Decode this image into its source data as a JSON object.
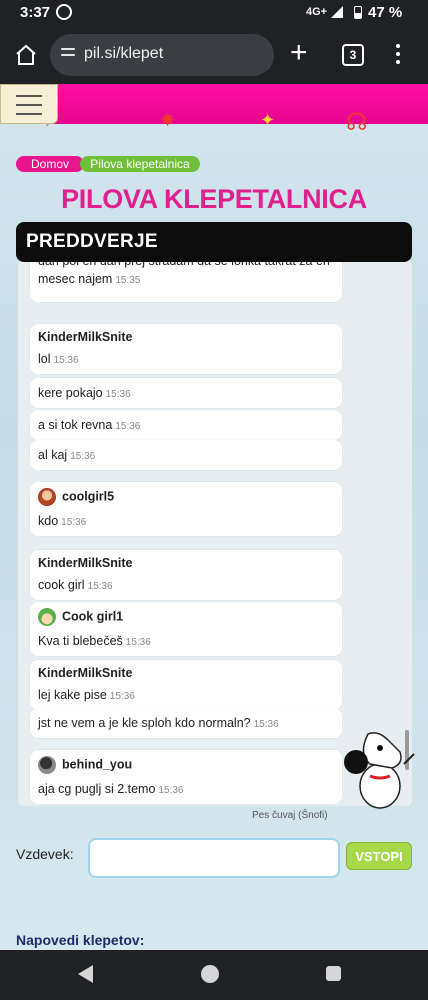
{
  "status": {
    "time": "3:37",
    "network": "4G+",
    "battery": "47 %"
  },
  "browser": {
    "url": "pil.si/klepet",
    "tab_count": "3"
  },
  "breadcrumb": {
    "home": "Domov",
    "current": "Pilova klepetalnica"
  },
  "page_title": "PILOVA KLEPETALNICA",
  "room_title": "PREDDVERJE",
  "messages": [
    {
      "user": "",
      "text": "dan pol en dan prej stradam da se lohka takrat za en mesec najem",
      "time": "15:35",
      "avatar": ""
    },
    {
      "user": "KinderMilkSnite",
      "text": "lol",
      "time": "15:36",
      "avatar": ""
    },
    {
      "user": "",
      "text": "kere pokajo",
      "time": "15:36",
      "avatar": ""
    },
    {
      "user": "",
      "text": "a si tok revna",
      "time": "15:36",
      "avatar": ""
    },
    {
      "user": "",
      "text": "al kaj",
      "time": "15:36",
      "avatar": ""
    },
    {
      "user": "coolgirl5",
      "text": "kdo",
      "time": "15:36",
      "avatar": "girl"
    },
    {
      "user": "KinderMilkSnite",
      "text": "cook girl",
      "time": "15:36",
      "avatar": ""
    },
    {
      "user": "Cook girl1",
      "text": "Kva ti blebečeš",
      "time": "15:36",
      "avatar": "cook"
    },
    {
      "user": "KinderMilkSnite",
      "text": "lej kake pise",
      "time": "15:36",
      "avatar": ""
    },
    {
      "user": "",
      "text": "jst ne vem a je kle sploh kdo normaln?",
      "time": "15:36",
      "avatar": ""
    },
    {
      "user": "behind_you",
      "text": "aja cg puglj si 2.temo",
      "time": "15:36",
      "avatar": "ninja"
    }
  ],
  "watchdog_caption": "Pes čuvaj (Šnofi)",
  "form": {
    "label": "Vzdevek:",
    "value": "",
    "submit": "VSTOPI"
  },
  "hints_title": "Napovedi klepetov:",
  "colors": {
    "pink": "#e6068e",
    "title": "#e0208f",
    "green": "#a7d84a"
  }
}
